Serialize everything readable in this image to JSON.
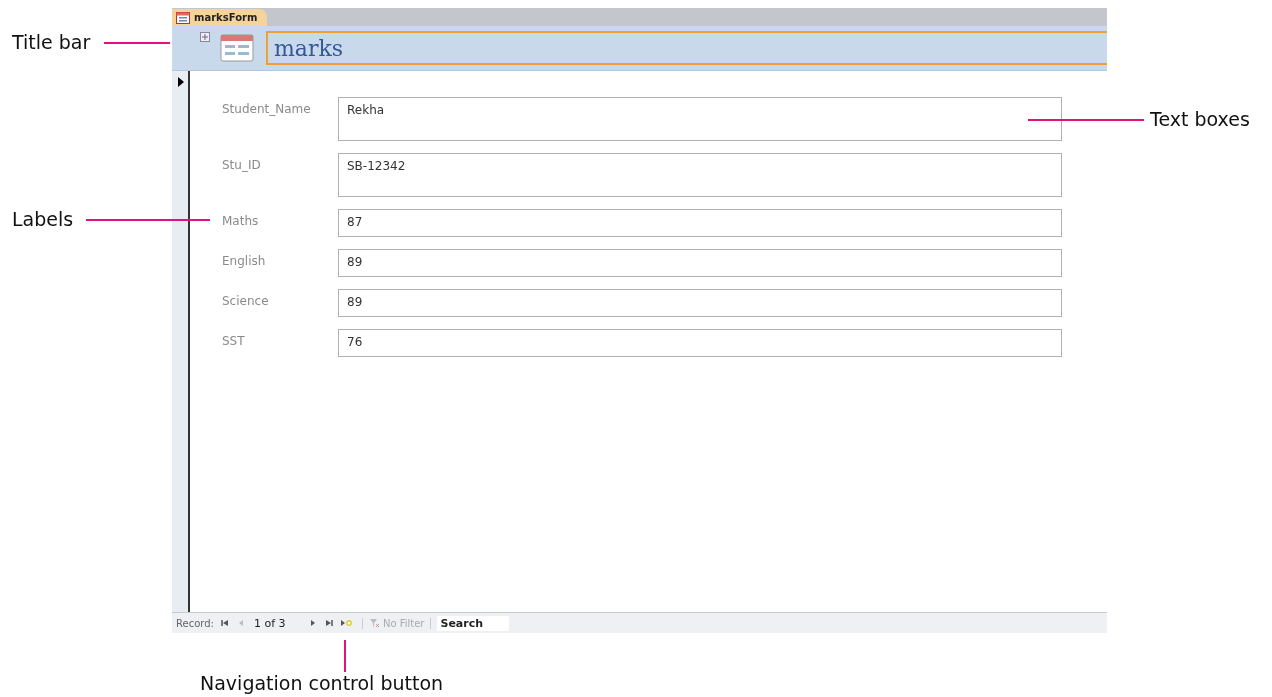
{
  "form": {
    "tab": "marksForm",
    "title": "marks",
    "fields": [
      {
        "label": "Student_Name",
        "value": "Rekha",
        "kind": "multiline"
      },
      {
        "label": "Stu_ID",
        "value": "SB-12342",
        "kind": "multiline"
      },
      {
        "label": "Maths",
        "value": "87",
        "kind": "single"
      },
      {
        "label": "English",
        "value": "89",
        "kind": "single"
      },
      {
        "label": "Science",
        "value": "89",
        "kind": "single"
      },
      {
        "label": "SST",
        "value": "76",
        "kind": "single"
      }
    ],
    "navigation": {
      "label": "Record:",
      "position": "1 of 3",
      "filter": "No Filter",
      "search": "Search"
    }
  },
  "callouts": [
    {
      "text": "Title bar"
    },
    {
      "text": "Labels"
    },
    {
      "text": "Text boxes"
    },
    {
      "text": "Navigation control button"
    }
  ]
}
